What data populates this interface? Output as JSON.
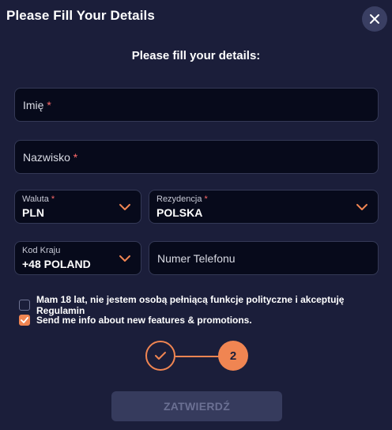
{
  "dialog": {
    "title": "Please Fill Your Details",
    "subtitle": "Please fill your details:"
  },
  "fields": {
    "first_name": {
      "placeholder": "Imię",
      "required_mark": "*"
    },
    "last_name": {
      "placeholder": "Nazwisko",
      "required_mark": "*"
    },
    "currency": {
      "label": "Waluta",
      "required_mark": "*",
      "value": "PLN"
    },
    "residence": {
      "label": "Rezydencja",
      "required_mark": "*",
      "value": "POLSKA"
    },
    "country_code": {
      "label": "Kod Kraju",
      "value": "+48 POLAND"
    },
    "phone": {
      "placeholder": "Numer Telefonu"
    }
  },
  "checkboxes": {
    "terms": {
      "label": "Mam 18 lat, nie jestem osobą pełniącą funkcje polityczne i akceptuję Regulamin",
      "checked": false
    },
    "promotions": {
      "label": "Send me info about new features & promotions.",
      "checked": true
    }
  },
  "steps": {
    "step2_label": "2"
  },
  "submit": {
    "label": "ZATWIERDŹ"
  },
  "icons": {
    "close": "close-icon",
    "chevron": "chevron-down-icon",
    "check": "check-icon"
  },
  "colors": {
    "background": "#1b1e3a",
    "field_bg": "#070a1b",
    "accent": "#f08552",
    "required": "#ff6b6b"
  }
}
